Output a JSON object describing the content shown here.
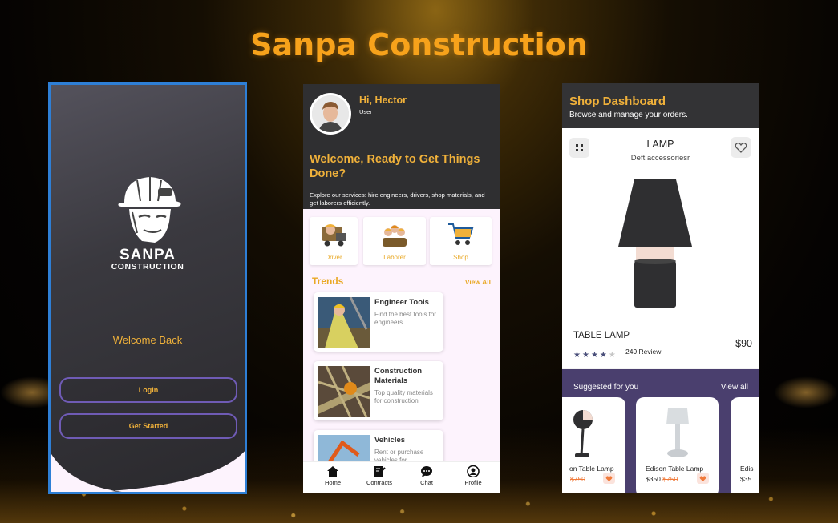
{
  "page_title": "Sanpa Construction",
  "colors": {
    "accent": "#f0b13a",
    "title": "#f7a21b",
    "dark": "#2f2f31",
    "purple": "#4a3f6e",
    "border_blue": "#2e7fd6"
  },
  "screen1": {
    "brand": "SANPA",
    "brand_sub": "CONSTRUCTION",
    "welcome": "Welcome Back",
    "login_label": "Login",
    "get_started_label": "Get Started"
  },
  "screen2": {
    "greeting": "Hi, Hector",
    "role": "User",
    "welcome": "Welcome, Ready to Get Things Done?",
    "description": "Explore our services: hire engineers, drivers, shop materials, and get laborers efficiently.",
    "categories": [
      {
        "label": "Driver",
        "icon": "driver-icon"
      },
      {
        "label": "Laborer",
        "icon": "laborer-icon"
      },
      {
        "label": "Shop",
        "icon": "cart-icon"
      }
    ],
    "trends_title": "Trends",
    "view_all": "View All",
    "trends": [
      {
        "title": "Engineer Tools",
        "desc": "Find the best tools for engineers"
      },
      {
        "title": "Construction Materials",
        "desc": "Top quality materials for construction"
      },
      {
        "title": "Vehicles",
        "desc": "Rent or purchase vehicles for construction"
      }
    ],
    "nav": [
      {
        "label": "Home",
        "icon": "home-icon"
      },
      {
        "label": "Contracts",
        "icon": "contract-icon"
      },
      {
        "label": "Chat",
        "icon": "chat-icon"
      },
      {
        "label": "Profile",
        "icon": "profile-icon"
      }
    ]
  },
  "screen3": {
    "header_title": "Shop Dashboard",
    "header_sub": "Browse and manage your orders.",
    "product_name": "LAMP",
    "product_sub": "Deft accessoriesr",
    "product_title": "TABLE LAMP",
    "rating_stars": 4,
    "reviews": "249 Review",
    "price": "$90",
    "suggested_title": "Suggested for you",
    "suggested_view_all": "View all",
    "suggested": [
      {
        "title": "on Table Lamp",
        "price": "",
        "old_price": "$750"
      },
      {
        "title": "Edison Table Lamp",
        "price": "$350",
        "old_price": "$750"
      },
      {
        "title": "Edis",
        "price": "$35",
        "old_price": ""
      }
    ]
  }
}
